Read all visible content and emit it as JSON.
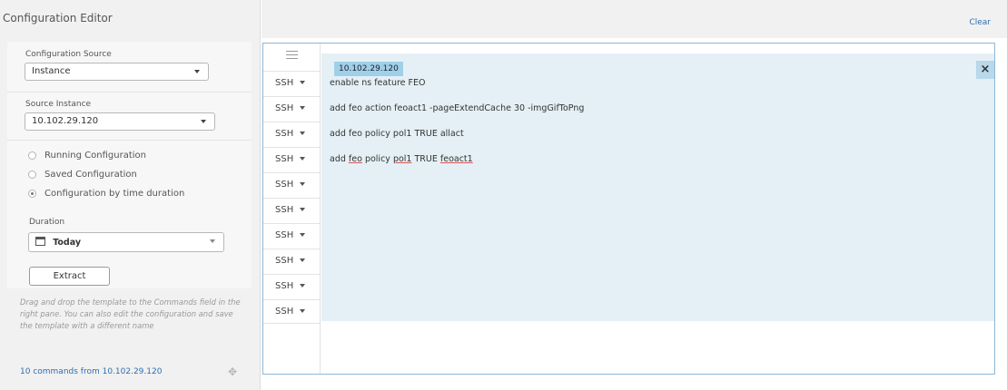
{
  "window": {
    "title": "Configuration Editor"
  },
  "left": {
    "config_source": {
      "label": "Configuration Source",
      "value": "Instance"
    },
    "source_instance": {
      "label": "Source Instance",
      "value": "10.102.29.120"
    },
    "radios": [
      {
        "label": "Running Configuration",
        "checked": false
      },
      {
        "label": "Saved Configuration",
        "checked": false
      },
      {
        "label": "Configuration by time duration",
        "checked": true
      }
    ],
    "duration": {
      "label": "Duration",
      "value": "Today",
      "icon": "calendar-icon"
    },
    "extract_label": "Extract",
    "hint": "Drag and drop the template to the Commands field in the right pane. You can also edit the configuration and save the template with a different name",
    "footer": "10 commands from 10.102.29.120",
    "move_icon": "move-icon"
  },
  "right": {
    "clear_label": "Clear",
    "menu_icon": "hamburger-icon",
    "ssh_rows": [
      "SSH",
      "SSH",
      "SSH",
      "SSH",
      "SSH",
      "SSH",
      "SSH",
      "SSH",
      "SSH",
      "SSH"
    ],
    "ip_tag": "10.102.29.120",
    "close_label": "×",
    "commands": [
      "enable ns feature FEO",
      "add feo action feoact1 -pageExtendCache 30 -imgGifToPng",
      "add feo policy pol1 TRUE allact",
      {
        "pre": "add ",
        "w1": "feo",
        "mid": " policy ",
        "w2": "pol1",
        "mid2": " TRUE ",
        "w3": "feoact1"
      }
    ]
  },
  "colors": {
    "accent": "#2d6fae",
    "editor_bg": "#e4f0f5",
    "tag_bg": "#9fd0e8"
  }
}
